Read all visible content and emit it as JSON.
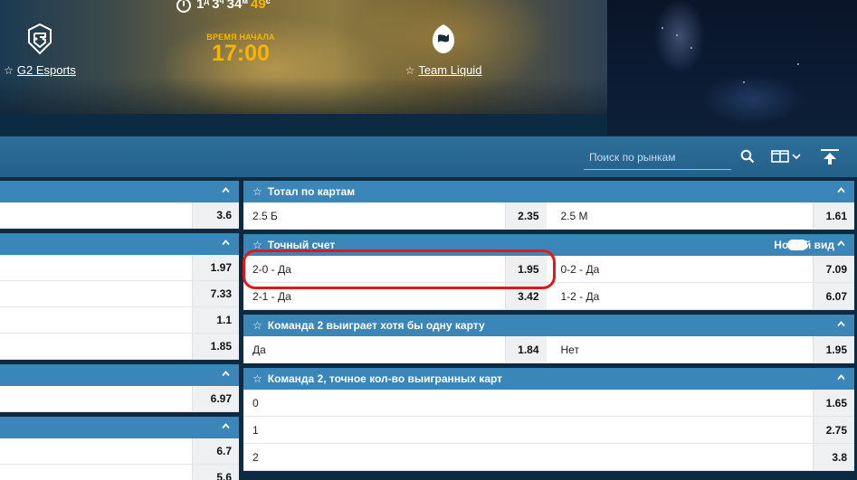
{
  "hero": {
    "countdown": {
      "days": "1",
      "days_unit": "д",
      "hours": "3",
      "hours_unit": "ч",
      "minutes": "34",
      "minutes_unit": "м",
      "seconds": "49",
      "seconds_unit": "с"
    },
    "team1": {
      "name": "G2 Esports"
    },
    "team2": {
      "name": "Team Liquid"
    },
    "start_label": "ВРЕМЯ НАЧАЛА",
    "start_time": "17:00"
  },
  "toolbar": {
    "search_placeholder": "Поиск по рынкам"
  },
  "left_markets": [
    {
      "rows": [
        {
          "label": "",
          "odds": "3.6"
        }
      ]
    },
    {
      "rows": [
        {
          "label": "",
          "odds": "1.97"
        },
        {
          "label": "",
          "odds": "7.33"
        },
        {
          "label": "",
          "odds": "1.1"
        },
        {
          "label": "",
          "odds": "1.85"
        }
      ]
    },
    {
      "rows": [
        {
          "label": "",
          "odds": "6.97"
        }
      ]
    },
    {
      "rows": [
        {
          "label": "",
          "odds": "6.7"
        },
        {
          "label": "",
          "odds": "5.6"
        }
      ]
    }
  ],
  "right_markets": {
    "total_maps": {
      "title": "Тотал по картам",
      "rows": [
        {
          "a_label": "2.5 Б",
          "a_odds": "2.35",
          "b_label": "2.5 М",
          "b_odds": "1.61"
        }
      ]
    },
    "exact_score": {
      "title": "Точный счет",
      "new_view_label": "Новый вид",
      "rows": [
        {
          "a_label": "2-0 - Да",
          "a_odds": "1.95",
          "b_label": "0-2 - Да",
          "b_odds": "7.09"
        },
        {
          "a_label": "2-1 - Да",
          "a_odds": "3.42",
          "b_label": "1-2 - Да",
          "b_odds": "6.07"
        }
      ]
    },
    "team2_wins_map": {
      "title": "Команда 2 выиграет хотя бы одну карту",
      "rows": [
        {
          "a_label": "Да",
          "a_odds": "1.84",
          "b_label": "Нет",
          "b_odds": "1.95"
        }
      ]
    },
    "team2_exact_maps": {
      "title": "Команда 2, точное кол-во выигранных карт",
      "rows": [
        {
          "label": "0",
          "odds": "1.65"
        },
        {
          "label": "1",
          "odds": "2.75"
        },
        {
          "label": "2",
          "odds": "3.8"
        }
      ]
    }
  },
  "colors": {
    "accent": "#f5b400",
    "header_blue": "#3b86b9",
    "highlight": "#e01818"
  }
}
